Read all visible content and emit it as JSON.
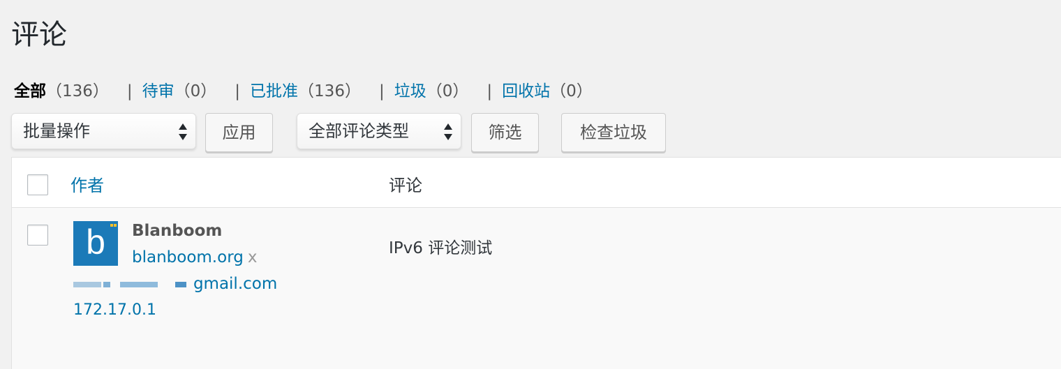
{
  "page_title": "评论",
  "status_filters": [
    {
      "label": "全部",
      "count": "（136）",
      "current": true
    },
    {
      "label": "待审",
      "count": "（0）"
    },
    {
      "label": "已批准",
      "count": "（136）"
    },
    {
      "label": "垃圾",
      "count": "（0）"
    },
    {
      "label": "回收站",
      "count": "（0）"
    }
  ],
  "separator": "|",
  "toolbar": {
    "bulk_actions_selected": "批量操作",
    "apply_label": "应用",
    "comment_type_selected": "全部评论类型",
    "filter_label": "筛选",
    "check_spam_label": "检查垃圾"
  },
  "table": {
    "columns": {
      "author": "作者",
      "comment": "评论"
    },
    "rows": [
      {
        "avatar_letter": "b",
        "author_name": "Blanboom",
        "author_url": "blanboom.org",
        "author_url_suffix": "x",
        "author_email_visible": "gmail.com",
        "author_ip": "172.17.0.1",
        "comment": "IPv6 评论测试"
      }
    ]
  },
  "colors": {
    "link": "#0073aa",
    "background": "#f1f1f1",
    "avatar_bg": "#1b7ab8"
  }
}
